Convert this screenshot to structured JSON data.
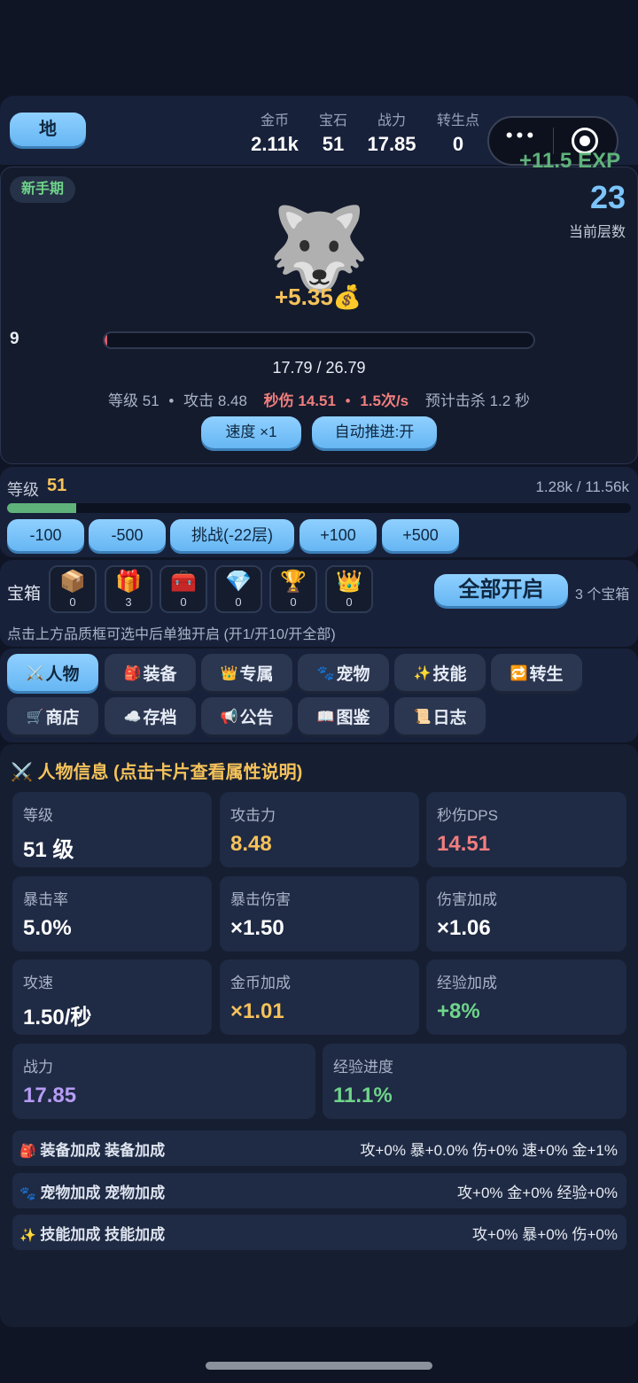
{
  "header": {
    "location_button": "地",
    "stats": [
      {
        "label": "金币",
        "value": "2.11k"
      },
      {
        "label": "宝石",
        "value": "51"
      },
      {
        "label": "战力",
        "value": "17.85"
      },
      {
        "label": "转生点",
        "value": "0"
      }
    ],
    "capsule_more": "•••",
    "capsule_target": "◎"
  },
  "battle": {
    "stage_badge": "新手期",
    "exp_gain": "+11.5 EXP",
    "current_floor": "23",
    "floor_label": "当前层数",
    "monster_icon": "🐺",
    "gold_gain": "+5.35💰",
    "left_counter": "9",
    "hp_text": "17.79 / 26.79",
    "hp_fraction": 0.006,
    "info_level": "等级 51",
    "info_attack": "攻击 8.48",
    "info_dps": "秒伤 14.51",
    "info_aps": "1.5次/s",
    "info_kill": "预计击杀 1.2 秒",
    "dot": "•",
    "speed_button": "速度 ×1",
    "auto_button": "自动推进:开"
  },
  "level": {
    "label": "等级",
    "value": "51",
    "exp_text": "1.28k / 11.56k",
    "exp_fraction": 0.111,
    "buttons": [
      "-100",
      "-500",
      "挑战(-22层)",
      "+100",
      "+500"
    ]
  },
  "chests": {
    "label": "宝箱",
    "items": [
      {
        "icon": "📦",
        "count": "0"
      },
      {
        "icon": "🎁",
        "count": "3"
      },
      {
        "icon": "🧰",
        "count": "0"
      },
      {
        "icon": "💎",
        "count": "0"
      },
      {
        "icon": "🏆",
        "count": "0"
      },
      {
        "icon": "👑",
        "count": "0"
      }
    ],
    "open_all": "全部开启",
    "count_text": "3 个宝箱",
    "hint": "点击上方品质框可选中后单独开启 (开1/开10/开全部)"
  },
  "tabs": [
    {
      "icon": "⚔️",
      "label": "人物"
    },
    {
      "icon": "🎒",
      "label": "装备"
    },
    {
      "icon": "👑",
      "label": "专属"
    },
    {
      "icon": "🐾",
      "label": "宠物"
    },
    {
      "icon": "✨",
      "label": "技能"
    },
    {
      "icon": "🔁",
      "label": "转生"
    },
    {
      "icon": "🛒",
      "label": "商店"
    },
    {
      "icon": "☁️",
      "label": "存档"
    },
    {
      "icon": "📢",
      "label": "公告"
    },
    {
      "icon": "📖",
      "label": "图鉴"
    },
    {
      "icon": "📜",
      "label": "日志"
    }
  ],
  "character": {
    "title_icon": "⚔️",
    "title": "人物信息 (点击卡片查看属性说明)",
    "stats": [
      {
        "label": "等级",
        "value": "51 级",
        "color": "#ffffff"
      },
      {
        "label": "攻击力",
        "value": "8.48",
        "color": "#f5c25a"
      },
      {
        "label": "秒伤DPS",
        "value": "14.51",
        "color": "#f07e7e"
      },
      {
        "label": "暴击率",
        "value": "5.0%",
        "color": "#ffffff"
      },
      {
        "label": "暴击伤害",
        "value": "×1.50",
        "color": "#ffffff"
      },
      {
        "label": "伤害加成",
        "value": "×1.06",
        "color": "#ffffff"
      },
      {
        "label": "攻速",
        "value": "1.50/秒",
        "color": "#ffffff"
      },
      {
        "label": "金币加成",
        "value": "×1.01",
        "color": "#f5c25a"
      },
      {
        "label": "经验加成",
        "value": "+8%",
        "color": "#6fd48a"
      },
      {
        "label": "战力",
        "value": "17.85",
        "color": "#b69cf5"
      },
      {
        "label": "经验进度",
        "value": "11.1%",
        "color": "#6fd48a"
      }
    ],
    "bonuses": [
      {
        "icon": "🎒",
        "label": "装备加成 装备加成",
        "value": "攻+0% 暴+0.0% 伤+0% 速+0% 金+1%"
      },
      {
        "icon": "🐾",
        "label": "宠物加成 宠物加成",
        "value": "攻+0% 金+0% 经验+0%"
      },
      {
        "icon": "✨",
        "label": "技能加成 技能加成",
        "value": "攻+0% 暴+0% 伤+0%"
      }
    ]
  },
  "colors": {
    "accent": "#7cc4fb",
    "gold": "#f5c25a",
    "red": "#f07e7e",
    "green": "#6fd48a",
    "purple": "#b69cf5",
    "background": "#0f1524"
  }
}
